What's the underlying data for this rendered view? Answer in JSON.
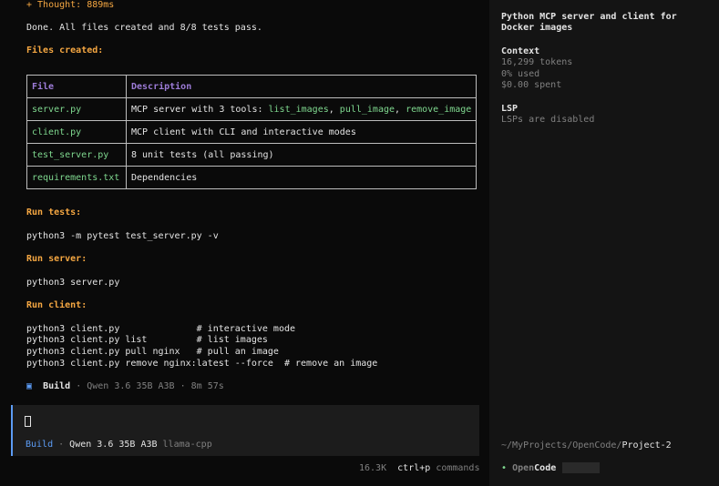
{
  "thought": "+ Thought: 889ms",
  "done_message": "Done. All files created and 8/8 tests pass.",
  "files_heading": "Files created:",
  "table": {
    "headers": [
      "File",
      "Description"
    ],
    "rows": [
      {
        "file": "server.py",
        "desc_prefix": "MCP server with 3 tools: ",
        "tools": [
          "list_images",
          "pull_image",
          "remove_image"
        ],
        "sep": ", "
      },
      {
        "file": "client.py",
        "desc": "MCP client with CLI and interactive modes"
      },
      {
        "file": "test_server.py",
        "desc": "8 unit tests (all passing)"
      },
      {
        "file": "requirements.txt",
        "desc": "Dependencies"
      }
    ]
  },
  "run_tests": {
    "heading": "Run tests:",
    "command": "python3 -m pytest test_server.py -v"
  },
  "run_server": {
    "heading": "Run server:",
    "command": "python3 server.py"
  },
  "run_client": {
    "heading": "Run client:",
    "lines": [
      "python3 client.py              # interactive mode",
      "python3 client.py list         # list images",
      "python3 client.py pull nginx   # pull an image",
      "python3 client.py remove nginx:latest --force  # remove an image"
    ]
  },
  "build_status": {
    "icon": "square-icon",
    "mode": "Build",
    "sep": " · ",
    "model": "Qwen 3.6 35B A3B",
    "duration": "8m 57s"
  },
  "input": {
    "mode": "Build",
    "sep": " · ",
    "model": "Qwen 3.6 35B A3B",
    "provider": "llama-cpp"
  },
  "footer": {
    "tokens": "16.3K",
    "shortcut": "ctrl+p",
    "shortcut_label": "commands"
  },
  "sidebar": {
    "title": "Python MCP server and client for Docker images",
    "context": {
      "heading": "Context",
      "tokens": "16,299 tokens",
      "used": "0% used",
      "spent": "$0.00 spent"
    },
    "lsp": {
      "heading": "LSP",
      "status": "LSPs are disabled"
    },
    "path_prefix": "~/MyProjects/OpenCode/",
    "path_project": "Project-2",
    "brand_dot": "•",
    "brand_open": "Open",
    "brand_code": "Code"
  },
  "colors": {
    "accent": "#f5a742",
    "file": "#7fd88f",
    "header": "#9d7cd8",
    "build": "#5c9cf5"
  }
}
